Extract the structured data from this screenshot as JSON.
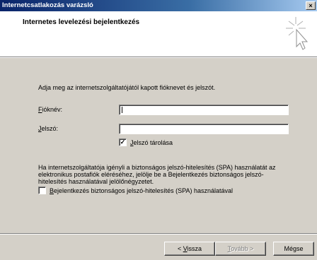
{
  "window": {
    "title": "Internetcsatlakozás varázsló",
    "close_label": "×"
  },
  "header": {
    "title": "Internetes levelezési bejelentkezés",
    "icon": "wizard-icon"
  },
  "main": {
    "intro": "Adja meg az internetszolgáltatójától kapott fióknevet és jelszót.",
    "account_label": "Fióknév:",
    "account_value": "",
    "password_label": "Jelszó:",
    "password_value": "",
    "remember_password_label": "Jelszó tárolása",
    "remember_password_checked": true,
    "spa_paragraph": "Ha internetszolgáltatója igényli a biztonságos jelszó-hitelesítés (SPA) használatát az elektronikus postafiók eléréséhez, jelölje be a Bejelentkezés biztonságos jelszó-hitelesítés használatával jelölőnégyzetet.",
    "spa_checkbox_label": "Bejelentkezés biztonságos jelszó-hitelesítés (SPA) használatával",
    "spa_checked": false
  },
  "footer": {
    "back_label": "< Vissza",
    "next_label": "Tovább >",
    "cancel_label": "Mégse"
  }
}
